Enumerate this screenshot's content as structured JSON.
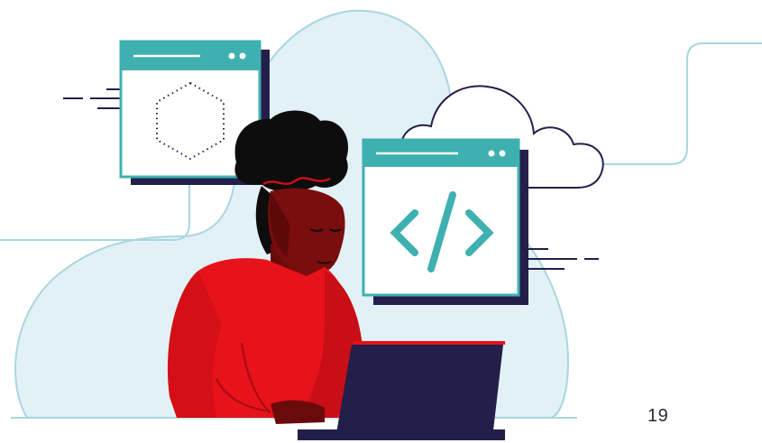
{
  "page": {
    "number": "19"
  },
  "illustration": {
    "subject": "person-using-laptop-cloud-development",
    "icons": [
      "hexagon-placeholder-icon",
      "code-brackets-icon",
      "cloud-icon"
    ]
  },
  "colors": {
    "teal_accent": "#3fb0b0",
    "light_blue_bg": "#e2f1f6",
    "outline_blue": "#a8d6df",
    "navy": "#231f4a",
    "shirt_red": "#e8121a",
    "skin_dark": "#7a0d0d",
    "hair": "#0d0d0d"
  }
}
